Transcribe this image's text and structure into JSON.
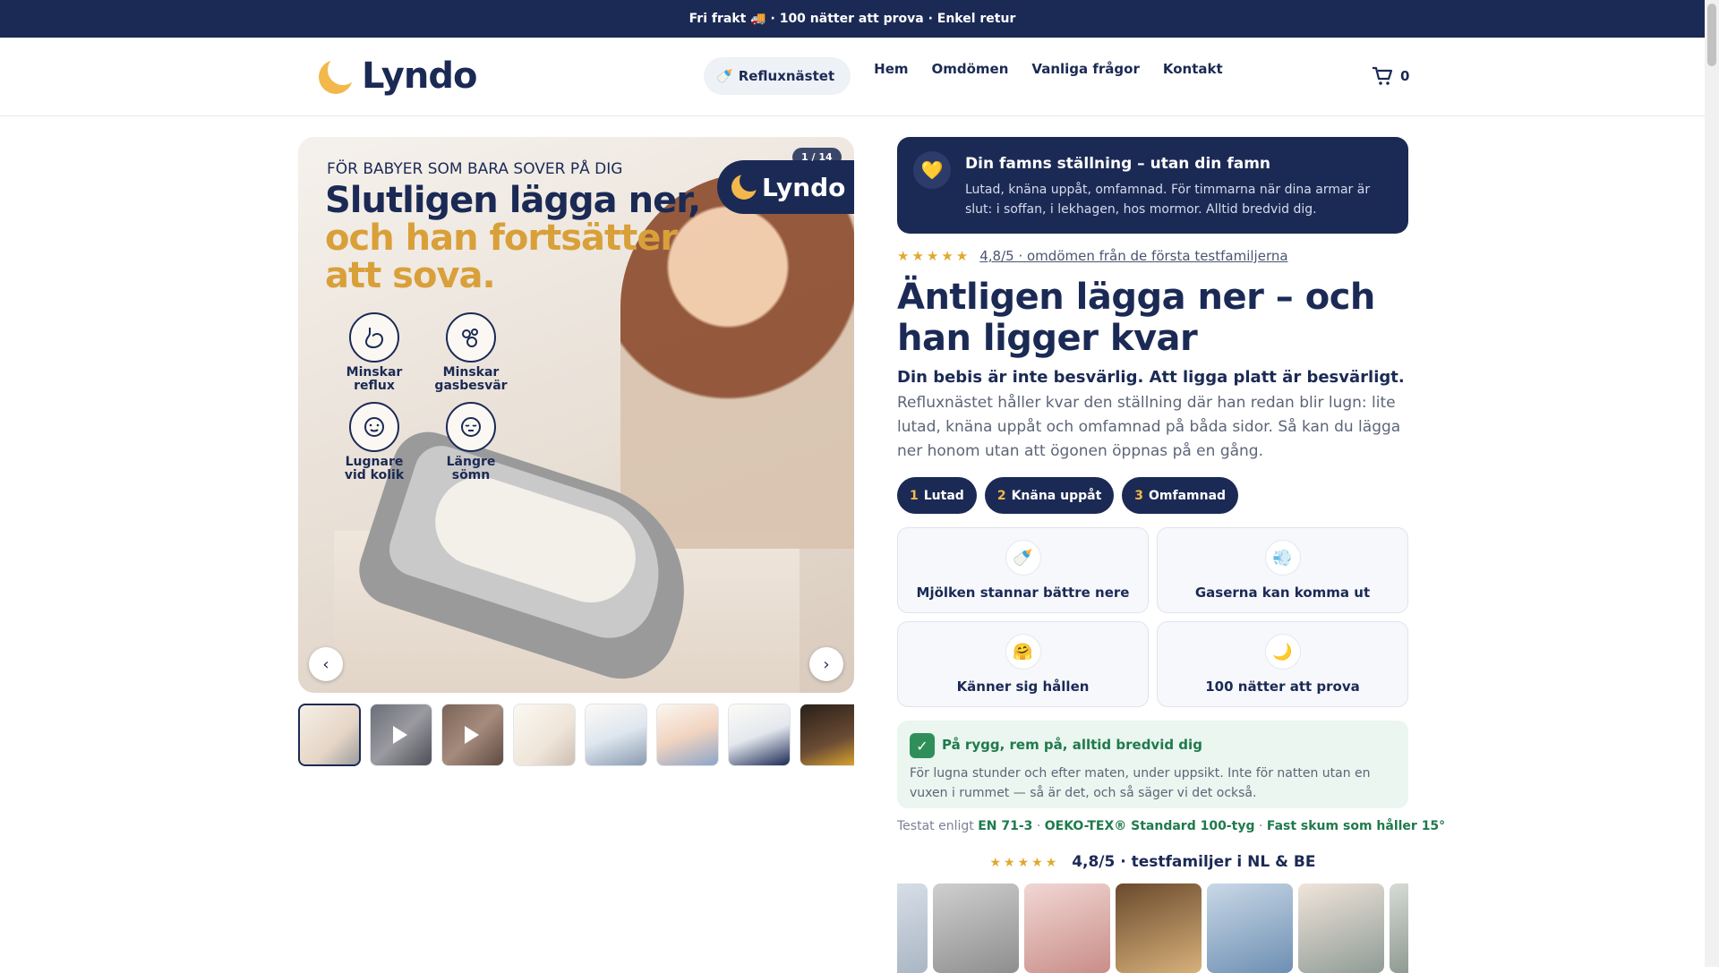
{
  "announcement": "Fri frakt 🚚 · 100 nätter att prova · Enkel retur",
  "header": {
    "logo": "Lyndo",
    "nav_pill": "Refluxnästet",
    "nav_pill_icon": "🍼",
    "links": [
      "Hem",
      "Omdömen",
      "Vanliga frågor",
      "Kontakt"
    ],
    "cart_count": "0"
  },
  "gallery": {
    "counter": "1 / 14",
    "badge_logo": "Lyndo",
    "eyebrow": "FÖR BABYER SOM BARA SOVER PÅ DIG",
    "headline_1": "Slutligen lägga ner,",
    "headline_2": "och han fortsätter att sova.",
    "features": [
      {
        "label": "Minskar reflux",
        "icon": "stomach-icon"
      },
      {
        "label": "Minskar gasbesvär",
        "icon": "bubbles-icon"
      },
      {
        "label": "Lugnare vid kolik",
        "icon": "baby-face-icon"
      },
      {
        "label": "Längre sömn",
        "icon": "sleeping-baby-icon"
      }
    ],
    "prev": "‹",
    "next": "›"
  },
  "promo": {
    "icon": "💛",
    "title": "Din famns ställning – utan din famn",
    "text": "Lutad, knäna uppåt, omfamnad. För timmarna när dina armar är slut: i soffan, i lekhagen, hos mormor. Alltid bredvid dig."
  },
  "rating": {
    "stars": "★★★★★",
    "text": "4,8/5 · omdömen från de första testfamiljerna"
  },
  "title": "Äntligen lägga ner – och han ligger kvar",
  "subtitle": "Din bebis är inte besvärlig. Att ligga platt är besvärligt.",
  "description": "Refluxnästet håller kvar den ställning där han redan blir lugn: lite lutad, knäna uppåt och omfamnad på båda sidor. Så kan du lägga ner honom utan att ögonen öppnas på en gång.",
  "steps": [
    {
      "n": "1",
      "label": "Lutad"
    },
    {
      "n": "2",
      "label": "Knäna uppåt"
    },
    {
      "n": "3",
      "label": "Omfamnad"
    }
  ],
  "cards": [
    {
      "icon": "🍼",
      "label": "Mjölken stannar bättre nere"
    },
    {
      "icon": "💨",
      "label": "Gaserna kan komma ut"
    },
    {
      "icon": "🤗",
      "label": "Känner sig hållen"
    },
    {
      "icon": "🌙",
      "label": "100 nätter att prova"
    }
  ],
  "safety": {
    "check": "✓",
    "title": "På rygg, rem på, alltid bredvid dig",
    "text": "För lugna stunder och efter maten, under uppsikt. Inte för natten utan en vuxen i rummet — så är det, och så säger vi det också."
  },
  "tested": {
    "prefix": "Testat enligt",
    "en": "EN 71-3",
    "sep1": " · ",
    "oeko": "OEKO-TEX® Standard 100-tyg",
    "sep2": " · ",
    "foam": "Fast skum som håller 15°"
  },
  "families": {
    "stars": "★★★★★",
    "text": "4,8/5 · testfamiljer i NL & BE"
  }
}
